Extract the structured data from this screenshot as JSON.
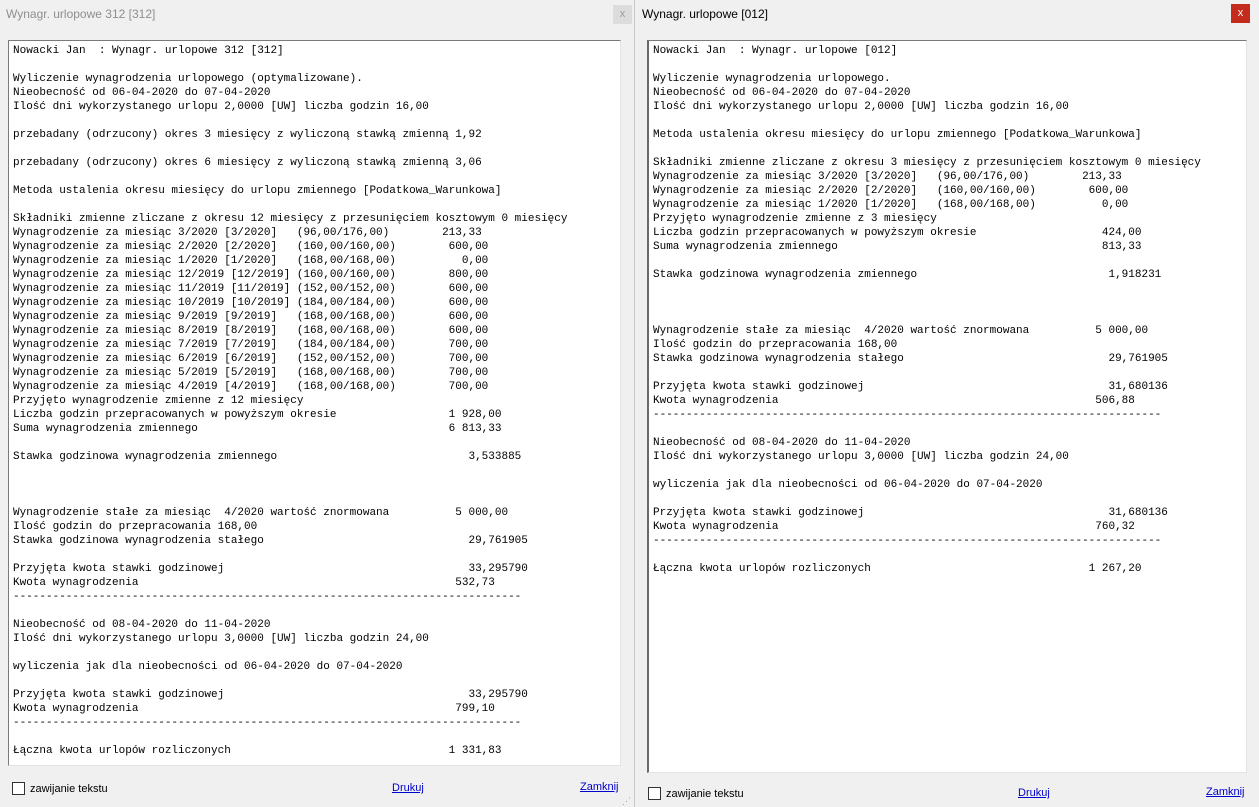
{
  "left_window": {
    "title": "Wynagr. urlopowe 312 [312]",
    "close_symbol": "x",
    "report_lines": [
      "Nowacki Jan  : Wynagr. urlopowe 312 [312]",
      "",
      "Wyliczenie wynagrodzenia urlopowego (optymalizowane).",
      "Nieobecność od 06-04-2020 do 07-04-2020",
      "Ilość dni wykorzystanego urlopu 2,0000 [UW] liczba godzin 16,00",
      "",
      "przebadany (odrzucony) okres 3 miesięcy z wyliczoną stawką zmienną 1,92",
      "",
      "przebadany (odrzucony) okres 6 miesięcy z wyliczoną stawką zmienną 3,06",
      "",
      "Metoda ustalenia okresu miesięcy do urlopu zmiennego [Podatkowa_Warunkowa]",
      "",
      "Składniki zmienne zliczane z okresu 12 miesięcy z przesunięciem kosztowym 0 miesięcy",
      "Wynagrodzenie za miesiąc 3/2020 [3/2020]   (96,00/176,00)        213,33",
      "Wynagrodzenie za miesiąc 2/2020 [2/2020]   (160,00/160,00)        600,00",
      "Wynagrodzenie za miesiąc 1/2020 [1/2020]   (168,00/168,00)          0,00",
      "Wynagrodzenie za miesiąc 12/2019 [12/2019] (160,00/160,00)        800,00",
      "Wynagrodzenie za miesiąc 11/2019 [11/2019] (152,00/152,00)        600,00",
      "Wynagrodzenie za miesiąc 10/2019 [10/2019] (184,00/184,00)        600,00",
      "Wynagrodzenie za miesiąc 9/2019 [9/2019]   (168,00/168,00)        600,00",
      "Wynagrodzenie za miesiąc 8/2019 [8/2019]   (168,00/168,00)        600,00",
      "Wynagrodzenie za miesiąc 7/2019 [7/2019]   (184,00/184,00)        700,00",
      "Wynagrodzenie za miesiąc 6/2019 [6/2019]   (152,00/152,00)        700,00",
      "Wynagrodzenie za miesiąc 5/2019 [5/2019]   (168,00/168,00)        700,00",
      "Wynagrodzenie za miesiąc 4/2019 [4/2019]   (168,00/168,00)        700,00",
      "Przyjęto wynagrodzenie zmienne z 12 miesięcy",
      "Liczba godzin przepracowanych w powyższym okresie                 1 928,00",
      "Suma wynagrodzenia zmiennego                                      6 813,33",
      "",
      "Stawka godzinowa wynagrodzenia zmiennego                             3,533885",
      "",
      "",
      "",
      "Wynagrodzenie stałe za miesiąc  4/2020 wartość znormowana          5 000,00",
      "Ilość godzin do przepracowania 168,00",
      "Stawka godzinowa wynagrodzenia stałego                               29,761905",
      "",
      "Przyjęta kwota stawki godzinowej                                     33,295790",
      "Kwota wynagrodzenia                                                532,73",
      "-----------------------------------------------------------------------------",
      "",
      "Nieobecność od 08-04-2020 do 11-04-2020",
      "Ilość dni wykorzystanego urlopu 3,0000 [UW] liczba godzin 24,00",
      "",
      "wyliczenia jak dla nieobecności od 06-04-2020 do 07-04-2020",
      "",
      "Przyjęta kwota stawki godzinowej                                     33,295790",
      "Kwota wynagrodzenia                                                799,10",
      "-----------------------------------------------------------------------------",
      "",
      "Łączna kwota urlopów rozliczonych                                 1 331,83"
    ],
    "wrap_label": "zawijanie tekstu",
    "print_label": "Drukuj",
    "close_label": "Zamknij"
  },
  "right_window": {
    "title": "Wynagr. urlopowe [012]",
    "close_symbol": "x",
    "report_lines": [
      "Nowacki Jan  : Wynagr. urlopowe [012]",
      "",
      "Wyliczenie wynagrodzenia urlopowego.",
      "Nieobecność od 06-04-2020 do 07-04-2020",
      "Ilość dni wykorzystanego urlopu 2,0000 [UW] liczba godzin 16,00",
      "",
      "Metoda ustalenia okresu miesięcy do urlopu zmiennego [Podatkowa_Warunkowa]",
      "",
      "Składniki zmienne zliczane z okresu 3 miesięcy z przesunięciem kosztowym 0 miesięcy",
      "Wynagrodzenie za miesiąc 3/2020 [3/2020]   (96,00/176,00)        213,33",
      "Wynagrodzenie za miesiąc 2/2020 [2/2020]   (160,00/160,00)        600,00",
      "Wynagrodzenie za miesiąc 1/2020 [1/2020]   (168,00/168,00)          0,00",
      "Przyjęto wynagrodzenie zmienne z 3 miesięcy",
      "Liczba godzin przepracowanych w powyższym okresie                   424,00",
      "Suma wynagrodzenia zmiennego                                        813,33",
      "",
      "Stawka godzinowa wynagrodzenia zmiennego                             1,918231",
      "",
      "",
      "",
      "Wynagrodzenie stałe za miesiąc  4/2020 wartość znormowana          5 000,00",
      "Ilość godzin do przepracowania 168,00",
      "Stawka godzinowa wynagrodzenia stałego                               29,761905",
      "",
      "Przyjęta kwota stawki godzinowej                                     31,680136",
      "Kwota wynagrodzenia                                                506,88",
      "-----------------------------------------------------------------------------",
      "",
      "Nieobecność od 08-04-2020 do 11-04-2020",
      "Ilość dni wykorzystanego urlopu 3,0000 [UW] liczba godzin 24,00",
      "",
      "wyliczenia jak dla nieobecności od 06-04-2020 do 07-04-2020",
      "",
      "Przyjęta kwota stawki godzinowej                                     31,680136",
      "Kwota wynagrodzenia                                                760,32",
      "-----------------------------------------------------------------------------",
      "",
      "Łączna kwota urlopów rozliczonych                                 1 267,20"
    ],
    "wrap_label": "zawijanie tekstu",
    "print_label": "Drukuj",
    "close_label": "Zamknij"
  }
}
